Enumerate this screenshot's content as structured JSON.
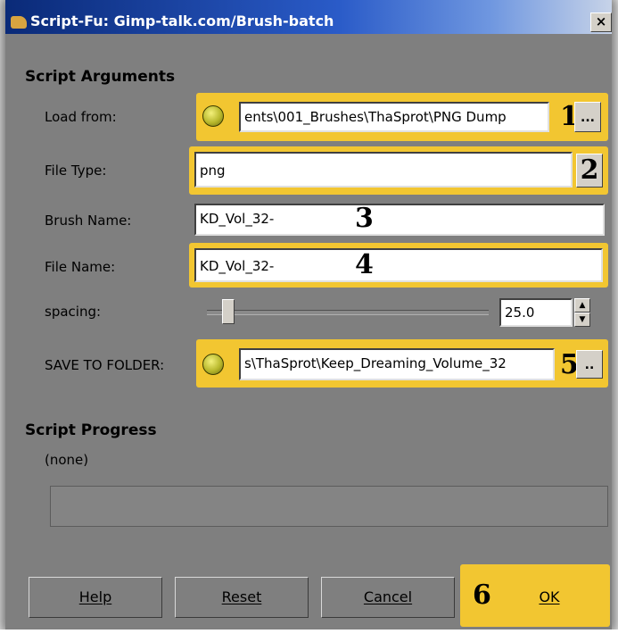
{
  "window": {
    "title": "Script-Fu: Gimp-talk.com/Brush-batch",
    "close_glyph": "×"
  },
  "arguments": {
    "section_title": "Script Arguments",
    "load_from": {
      "label": "Load from:",
      "value": "ents\\001_Brushes\\ThaSprot\\PNG Dump",
      "browse_label": "...",
      "badge": "1"
    },
    "file_type": {
      "label": "File Type:",
      "value": "png",
      "badge": "2"
    },
    "brush_name": {
      "label": "Brush Name:",
      "value": "KD_Vol_32-",
      "badge": "3"
    },
    "file_name": {
      "label": "File Name:",
      "value": "KD_Vol_32-",
      "badge": "4"
    },
    "spacing": {
      "label": "spacing:",
      "value": "25.0",
      "level_fraction": 0.05
    },
    "save_to_folder": {
      "label": "SAVE TO FOLDER:",
      "value": "s\\ThaSprot\\Keep_Dreaming_Volume_32",
      "browse_label": "..",
      "badge": "5"
    }
  },
  "progress": {
    "section_title": "Script Progress",
    "status": "(none)"
  },
  "buttons": {
    "help": "Help",
    "reset": "Reset",
    "cancel": "Cancel",
    "ok": "OK",
    "ok_badge": "6"
  },
  "colors": {
    "highlight": "#f2c631",
    "dialog_bg": "#7f7f7f",
    "title_bar": "#0a2a78"
  }
}
